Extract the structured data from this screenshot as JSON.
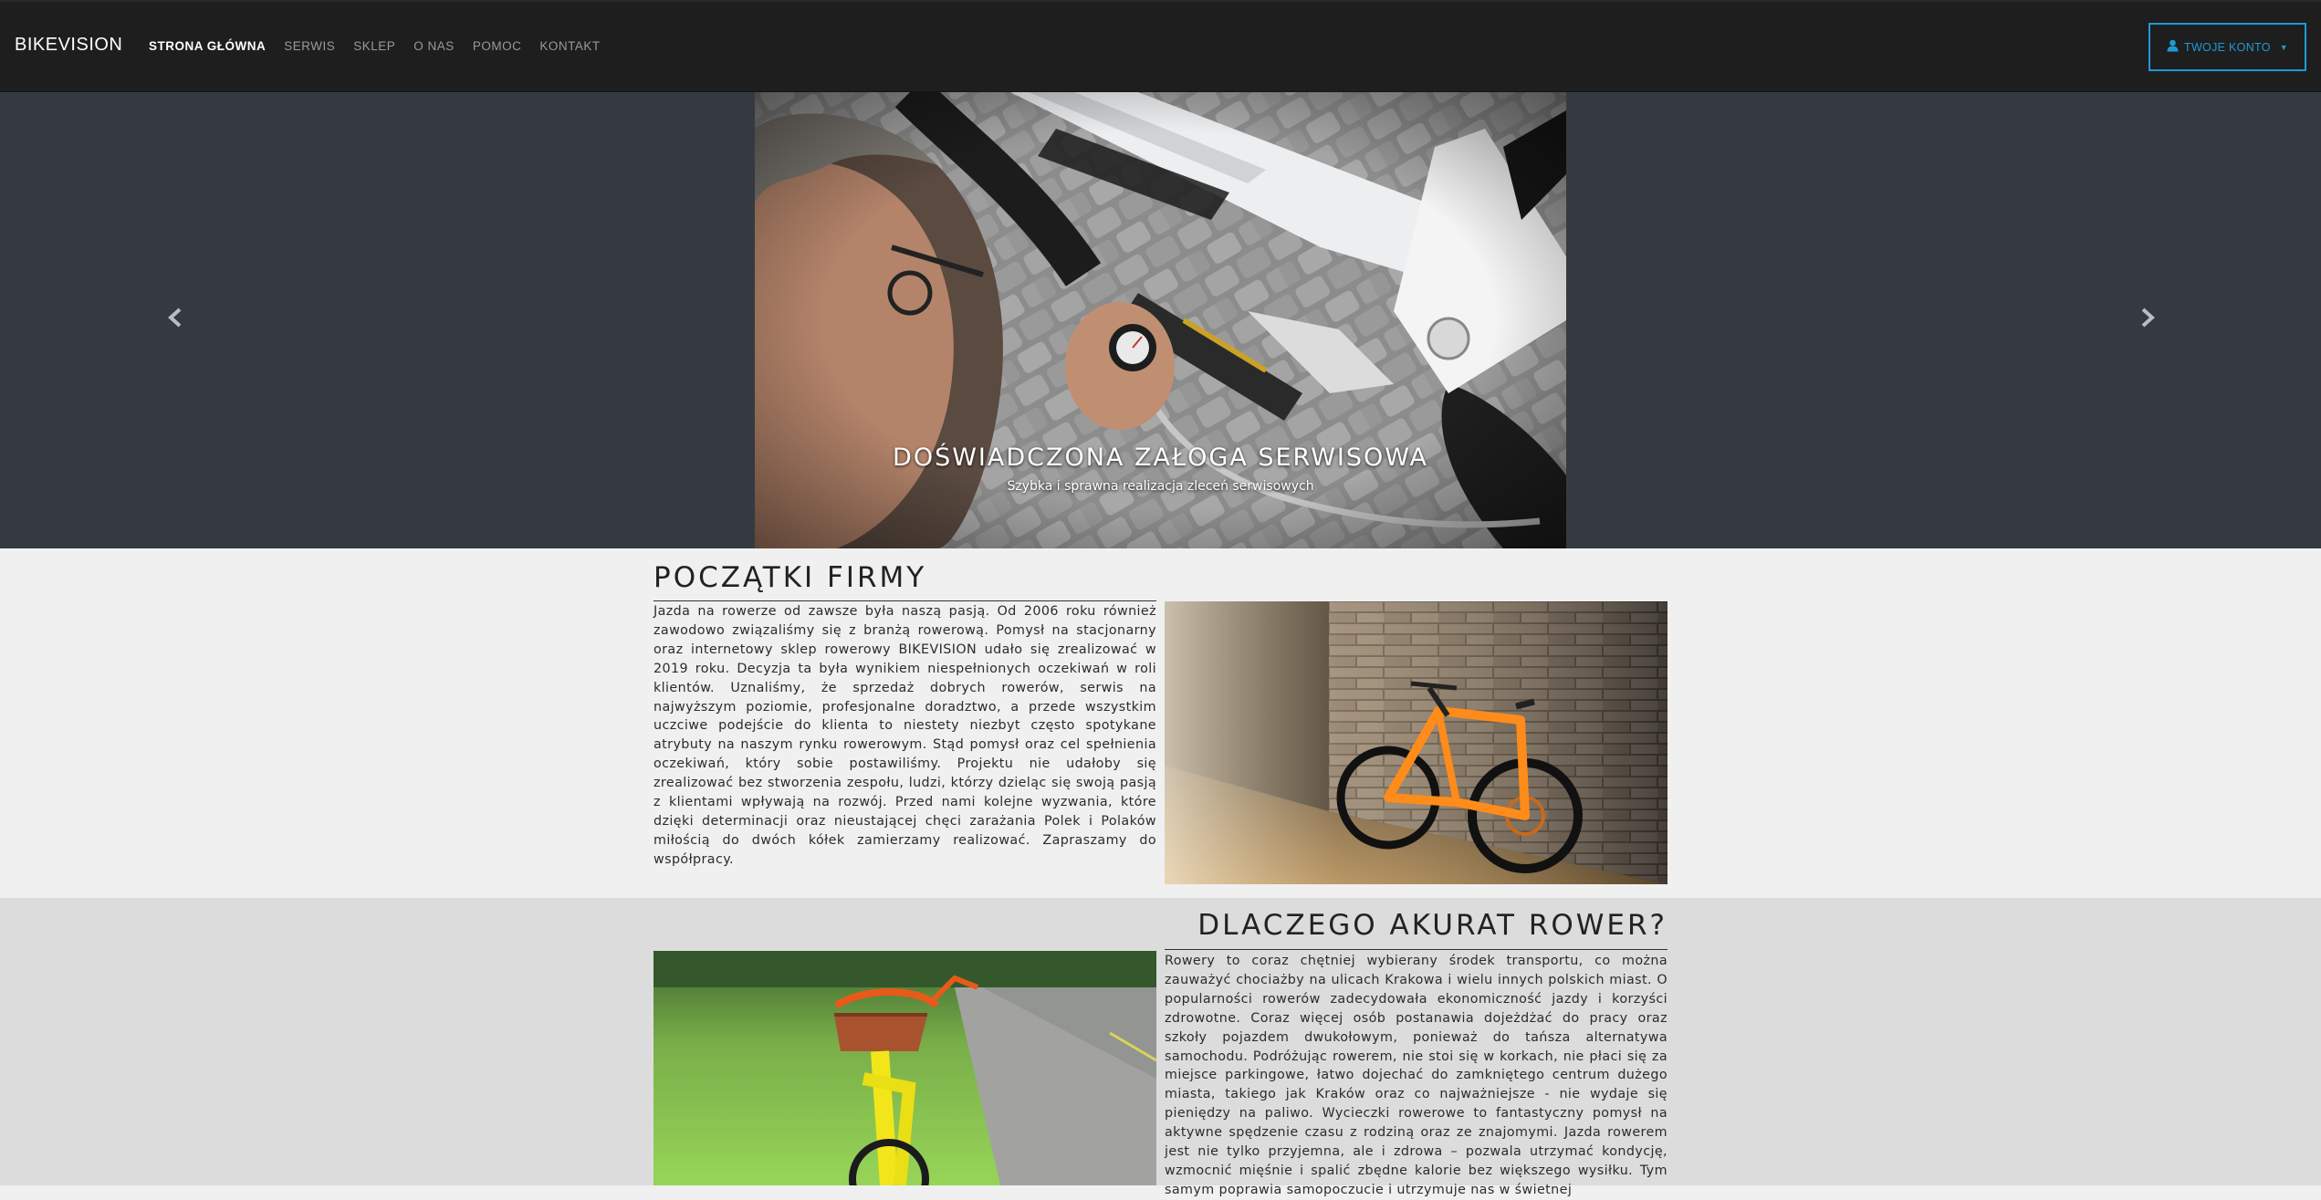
{
  "nav": {
    "brand": "BIKEVISION",
    "items": [
      {
        "label": "STRONA GŁÓWNA",
        "active": true
      },
      {
        "label": "SERWIS",
        "active": false
      },
      {
        "label": "SKLEP",
        "active": false
      },
      {
        "label": "O NAS",
        "active": false
      },
      {
        "label": "POMOC",
        "active": false
      },
      {
        "label": "KONTAKT",
        "active": false
      }
    ],
    "account_label": "TWOJE KONTO",
    "account_icon": "user-icon",
    "accent_color": "#1f9ad6"
  },
  "carousel": {
    "caption_title": "DOŚWIADCZONA ZAŁOGA SERWISOWA",
    "caption_subtitle": "Szybka i sprawna realizacja zleceń serwisowych",
    "prev_icon": "chevron-left-icon",
    "next_icon": "chevron-right-icon"
  },
  "about": {
    "title": "POCZĄTKI FIRMY",
    "text": "Jazda na rowerze od zawsze była naszą pasją. Od 2006 roku również zawodowo związaliśmy się z branżą rowerową. Pomysł na stacjonarny oraz internetowy sklep rowerowy BIKEVISION udało się zrealizować w 2019 roku. Decyzja ta była wynikiem niespełnionych oczekiwań w roli klientów. Uznaliśmy, że sprzedaż dobrych rowerów, serwis na najwyższym poziomie, profesjonalne doradztwo, a przede wszystkim uczciwe podejście do klienta to niestety niezbyt często spotykane atrybuty na naszym rynku rowerowym. Stąd pomysł oraz cel spełnienia oczekiwań, który sobie postawiliśmy. Projektu nie udałoby się zrealizować bez stworzenia zespołu, ludzi, którzy dzieląc się swoją pasją z klientami wpływają na rozwój. Przed nami kolejne wyzwania, które dzięki determinacji oraz nieustającej chęci zarażania Polek i Polaków miłością do dwóch kółek zamierzamy realizować. Zapraszamy do współpracy."
  },
  "why": {
    "title": "DLACZEGO AKURAT ROWER?",
    "text": "Rowery to coraz chętniej wybierany środek transportu, co można zauważyć chociażby na ulicach Krakowa i wielu innych polskich miast. O popularności rowerów zadecydowała ekonomiczność jazdy i korzyści zdrowotne. Coraz więcej osób postanawia dojeżdżać do pracy oraz szkoły pojazdem dwukołowym, ponieważ do tańsza alternatywa samochodu. Podróżując rowerem, nie stoi się w korkach, nie płaci się za miejsce parkingowe, łatwo dojechać do zamkniętego centrum dużego miasta, takiego jak Kraków oraz co najważniejsze - nie wydaje się pieniędzy na paliwo. Wycieczki rowerowe to fantastyczny pomysł na aktywne spędzenie czasu z rodziną oraz ze znajomymi. Jazda rowerem jest nie tylko przyjemna, ale i zdrowa – pozwala utrzymać kondycję, wzmocnić mięśnie i spalić zbędne kalorie bez większego wysiłku. Tym samym poprawia samopoczucie i utrzymuje nas w świetnej"
  }
}
